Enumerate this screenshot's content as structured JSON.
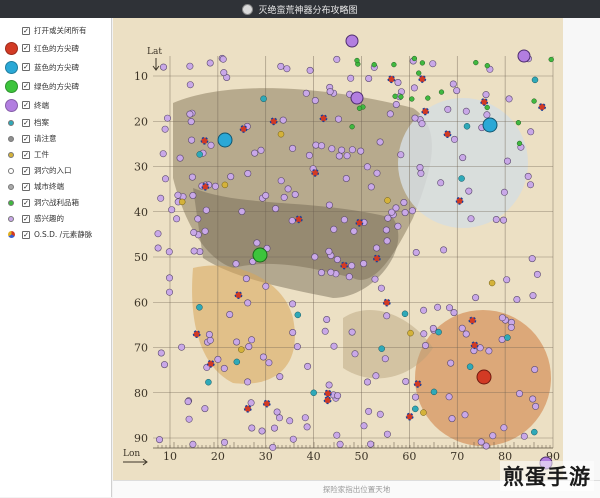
{
  "window": {
    "title": "灭绝蛮荒神器分布攻略图"
  },
  "legend": [
    {
      "label": "打开或关闭所有",
      "kind": "none",
      "color": ""
    },
    {
      "label": "红色的方尖碑",
      "kind": "big",
      "color": "#d23a24"
    },
    {
      "label": "蓝色的方尖碑",
      "kind": "big",
      "color": "#2aa8d6"
    },
    {
      "label": "绿色的方尖碑",
      "kind": "big",
      "color": "#3cc43c"
    },
    {
      "label": "终端",
      "kind": "big",
      "color": "#b27ee0"
    },
    {
      "label": "档案",
      "kind": "small",
      "color": "#2fa9b8"
    },
    {
      "label": "请注意",
      "kind": "small",
      "color": "#8f8f8f"
    },
    {
      "label": "工件",
      "kind": "small",
      "color": "#d4b23a"
    },
    {
      "label": "洞穴的入口",
      "kind": "small",
      "color": "#ffffff"
    },
    {
      "label": "城市终端",
      "kind": "small",
      "color": "#aaaaaa"
    },
    {
      "label": "洞穴战利品箱",
      "kind": "small",
      "color": "#40b840"
    },
    {
      "label": "感兴趣的",
      "kind": "small",
      "color": "#c9a8e8"
    },
    {
      "label": "O.S.D. /元素静脉",
      "kind": "pie",
      "color": "#3a5fd0"
    }
  ],
  "map": {
    "lat_label": "Lat",
    "lon_label": "Lon",
    "lat_ticks": [
      "10",
      "20",
      "30",
      "40",
      "50",
      "60",
      "70",
      "80",
      "90"
    ],
    "lon_ticks": [
      "10",
      "20",
      "30",
      "40",
      "50",
      "60",
      "70",
      "80",
      "90"
    ]
  },
  "bottom_text": "探险家指出位置天地",
  "watermark": "煎蛋手游"
}
